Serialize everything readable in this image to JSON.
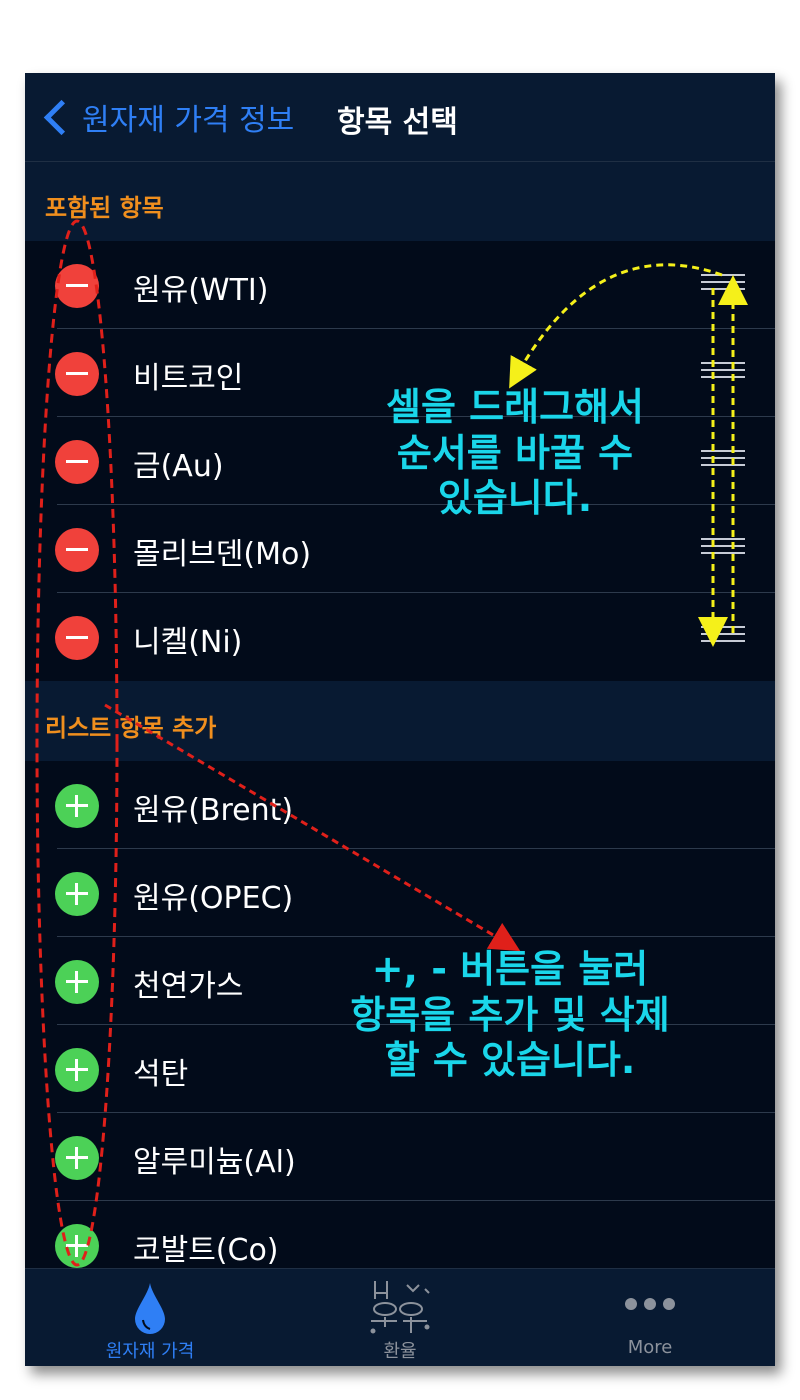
{
  "nav": {
    "back_label": "원자재 가격 정보",
    "title": "항목 선택"
  },
  "included": {
    "header": "포함된 항목",
    "items": [
      {
        "label": "원유(WTI)"
      },
      {
        "label": "비트코인"
      },
      {
        "label": "금(Au)"
      },
      {
        "label": "몰리브덴(Mo)"
      },
      {
        "label": "니켈(Ni)"
      }
    ]
  },
  "add": {
    "header": "리스트 항목 추가",
    "items": [
      {
        "label": "원유(Brent)"
      },
      {
        "label": "원유(OPEC)"
      },
      {
        "label": "천연가스"
      },
      {
        "label": "석탄"
      },
      {
        "label": "알루미늄(Al)"
      },
      {
        "label": "코발트(Co)"
      }
    ]
  },
  "annotations": {
    "drag": [
      "셀을 드래그해서",
      "순서를 바꿀 수",
      "있습니다."
    ],
    "buttons": [
      "+, - 버튼을 눌러",
      "항목을 추가 및 삭제",
      "할 수 있습니다."
    ]
  },
  "tabbar": {
    "tabs": [
      {
        "label": "원자재 가격",
        "icon": "drop-icon",
        "active": true
      },
      {
        "label": "환율",
        "icon": "exchange-icon",
        "active": false
      },
      {
        "label": "More",
        "icon": "more-icon",
        "active": false
      }
    ]
  },
  "colors": {
    "accent": "#2f7ff5",
    "section_header": "#f08f1e",
    "delete": "#f0413b",
    "insert": "#4cd157",
    "annotation_text": "#1ad6ea",
    "annotation_arrow_yellow": "#f5f01a",
    "annotation_arrow_red": "#e0201a"
  }
}
